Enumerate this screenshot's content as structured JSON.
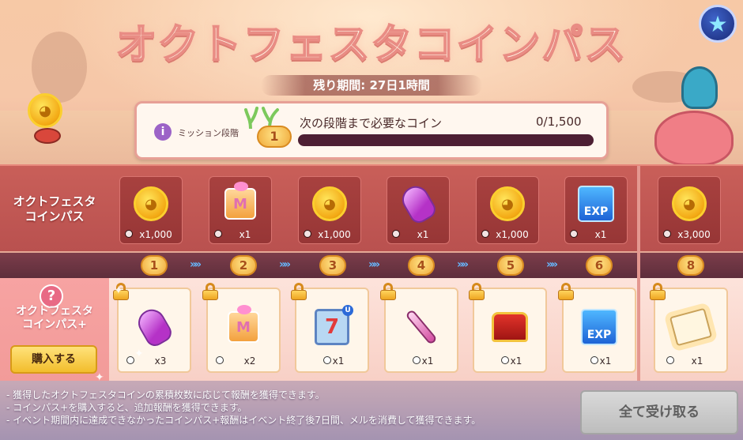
{
  "title": "オクトフェスタコインパス",
  "period": "残り期間: 27日1時間",
  "mission": {
    "label": "ミッション段階",
    "stage": "1",
    "need_text": "次の段階まで必要なコイン",
    "need_count": "0/1,500",
    "progress": 0
  },
  "free_pass": {
    "label_line1": "オクトフェスタ",
    "label_line2": "コインパス",
    "rewards": [
      {
        "icon": "coin-icon",
        "qty": "x1,000"
      },
      {
        "icon": "gift-box-icon",
        "qty": "x1"
      },
      {
        "icon": "coin-icon",
        "qty": "x1,000"
      },
      {
        "icon": "potion-icon",
        "qty": "x1"
      },
      {
        "icon": "coin-icon",
        "qty": "x1,000"
      },
      {
        "icon": "exp-ticket-icon",
        "qty": "x1"
      },
      {
        "icon": "coin-icon",
        "qty": "x3,000"
      }
    ]
  },
  "steps": [
    "1",
    "2",
    "3",
    "4",
    "5",
    "6",
    "8"
  ],
  "premium_pass": {
    "help": "?",
    "label_line1": "オクトフェスタ",
    "label_line2": "コインパス+",
    "buy_label": "購入する",
    "rewards": [
      {
        "icon": "potion-icon",
        "qty": "x3"
      },
      {
        "icon": "gift-box-icon",
        "qty": "x2"
      },
      {
        "icon": "lucky-seven-icon",
        "qty": "x1"
      },
      {
        "icon": "staff-icon",
        "qty": "x1"
      },
      {
        "icon": "treasure-chest-icon",
        "qty": "x1"
      },
      {
        "icon": "exp-ticket-icon",
        "qty": "x1"
      },
      {
        "icon": "scroll-icon",
        "qty": "x1"
      }
    ]
  },
  "notes": [
    "- 獲得したオクトフェスタコインの累積枚数に応じて報酬を獲得できます。",
    "- コインパス+を購入すると、追加報酬を獲得できます。",
    "- イベント期間内に達成できなかったコインパス+報酬はイベント終了後7日間、メルを消費して獲得できます。"
  ],
  "claim_all_label": "全て受け取る",
  "colors": {
    "title_stroke": "#e98c84",
    "free_row": "#c95f59",
    "premium_row": "#fde3db",
    "progress_track": "#4d1f33",
    "buy_button": "#f2bd2c",
    "claim_disabled": "#bdbdbd"
  }
}
